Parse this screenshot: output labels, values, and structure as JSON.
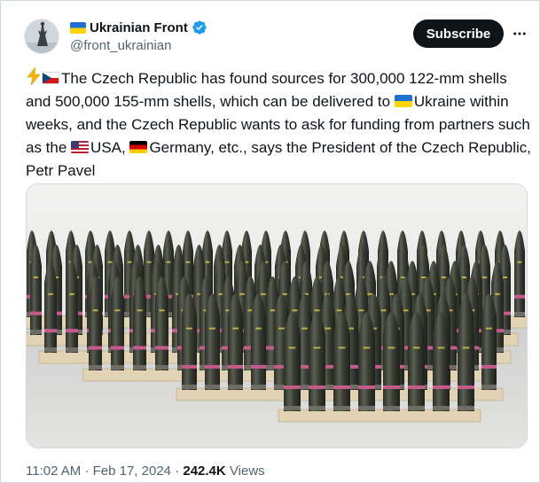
{
  "tweet": {
    "display_name": "Ukrainian Front",
    "handle": "@front_ukrainian",
    "subscribe_label": "Subscribe",
    "text_parts": [
      "The Czech Republic has found sources for 300,000 122-mm shells and 500,000 155-mm shells, which can be delivered to ",
      "Ukraine within weeks, and the Czech Republic wants to ask for funding from partners such as the ",
      "USA, ",
      "Germany, etc., says the President of the Czech Republic, Petr Pavel"
    ],
    "time": "11:02 AM",
    "sep1": "·",
    "date": "Feb 17, 2024",
    "sep2": "·",
    "views_count": "242.4K",
    "views_label": "Views"
  },
  "icons": {
    "verified": "verified-badge-icon",
    "more": "more-horizontal-icon",
    "lightning": "lightning-emoji-icon"
  },
  "colors": {
    "text": "#0f1419",
    "secondary": "#536471",
    "verified_blue": "#1d9bf0",
    "subscribe_bg": "#0f1419",
    "border": "#cfd9de"
  }
}
